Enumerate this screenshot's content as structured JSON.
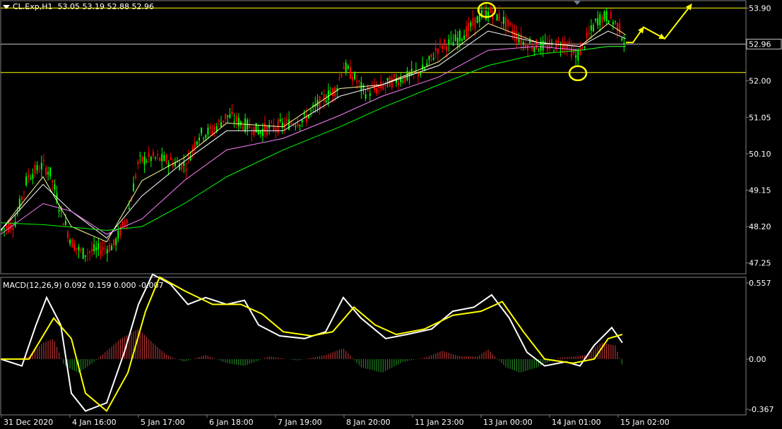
{
  "header": {
    "symbol": "CL.Exp,H1",
    "ohlc": "53.05 53.19 52.88 52.96"
  },
  "macd_header": {
    "label": "MACD(12,26,9)",
    "values": "0.092 0.159 0.000 -0.007"
  },
  "colors": {
    "background": "#000000",
    "bull_candle": "#00ff00",
    "bear_candle": "#ff0000",
    "level_line": "#ffff00",
    "bid_line": "#c0c0c0",
    "ma_fast": "#ffff99",
    "ma_mid": "#ffffff",
    "ma_slow": "#ff80ff",
    "ma_long": "#00ff00",
    "macd_main": "#ffffff",
    "macd_signal": "#ffff00",
    "annotation": "#ffff00"
  },
  "chart_data": [
    {
      "type": "candlestick",
      "price_axis": [
        "53.90",
        "52.96",
        "52.00",
        "51.05",
        "50.10",
        "49.15",
        "48.20",
        "47.25"
      ],
      "current_price": "52.96",
      "ylim": [
        46.95,
        54.0
      ],
      "time_axis": [
        "31 Dec 2020",
        "4 Jan 16:00",
        "5 Jan 17:00",
        "6 Jan 18:00",
        "7 Jan 19:00",
        "8 Jan 20:00",
        "11 Jan 23:00",
        "13 Jan 00:00",
        "14 Jan 01:00",
        "15 Jan 02:00"
      ],
      "horizontal_levels": [
        53.9,
        52.22
      ],
      "close_path": [
        [
          0,
          48.1
        ],
        [
          20,
          48.3
        ],
        [
          38,
          49.5
        ],
        [
          60,
          49.8
        ],
        [
          70,
          49.6
        ],
        [
          85,
          48.6
        ],
        [
          100,
          47.8
        ],
        [
          115,
          47.5
        ],
        [
          140,
          47.6
        ],
        [
          160,
          47.7
        ],
        [
          180,
          48.5
        ],
        [
          195,
          49.9
        ],
        [
          215,
          50.0
        ],
        [
          240,
          49.9
        ],
        [
          262,
          49.8
        ],
        [
          280,
          50.6
        ],
        [
          300,
          50.7
        ],
        [
          320,
          51.1
        ],
        [
          340,
          50.9
        ],
        [
          365,
          50.7
        ],
        [
          390,
          50.8
        ],
        [
          410,
          50.9
        ],
        [
          430,
          51.0
        ],
        [
          455,
          51.5
        ],
        [
          475,
          51.8
        ],
        [
          485,
          52.4
        ],
        [
          500,
          52.1
        ],
        [
          515,
          51.7
        ],
        [
          535,
          51.8
        ],
        [
          555,
          52.0
        ],
        [
          575,
          52.1
        ],
        [
          600,
          52.3
        ],
        [
          620,
          52.9
        ],
        [
          640,
          53.0
        ],
        [
          660,
          53.3
        ],
        [
          680,
          53.7
        ],
        [
          695,
          53.8
        ],
        [
          710,
          53.6
        ],
        [
          725,
          53.3
        ],
        [
          740,
          53.0
        ],
        [
          760,
          52.9
        ],
        [
          780,
          52.9
        ],
        [
          800,
          53.0
        ],
        [
          815,
          52.6
        ],
        [
          830,
          53.1
        ],
        [
          845,
          53.6
        ],
        [
          860,
          53.7
        ],
        [
          875,
          53.4
        ],
        [
          885,
          52.96
        ]
      ],
      "series": [
        {
          "name": "MA fast",
          "values": [
            [
              0,
              48.1
            ],
            [
              60,
              49.5
            ],
            [
              100,
              48.2
            ],
            [
              150,
              47.8
            ],
            [
              200,
              49.4
            ],
            [
              260,
              50.0
            ],
            [
              320,
              50.9
            ],
            [
              400,
              50.8
            ],
            [
              480,
              51.8
            ],
            [
              540,
              51.9
            ],
            [
              620,
              52.5
            ],
            [
              690,
              53.5
            ],
            [
              760,
              53.0
            ],
            [
              820,
              52.9
            ],
            [
              860,
              53.5
            ],
            [
              885,
              53.2
            ]
          ]
        },
        {
          "name": "MA mid",
          "values": [
            [
              0,
              48.1
            ],
            [
              60,
              49.3
            ],
            [
              100,
              48.6
            ],
            [
              150,
              47.9
            ],
            [
              200,
              49.0
            ],
            [
              260,
              49.9
            ],
            [
              320,
              50.7
            ],
            [
              400,
              50.7
            ],
            [
              480,
              51.6
            ],
            [
              540,
              51.9
            ],
            [
              620,
              52.4
            ],
            [
              690,
              53.3
            ],
            [
              760,
              53.0
            ],
            [
              820,
              52.9
            ],
            [
              860,
              53.3
            ],
            [
              885,
              53.1
            ]
          ]
        },
        {
          "name": "MA slow",
          "values": [
            [
              0,
              48.0
            ],
            [
              60,
              48.8
            ],
            [
              100,
              48.6
            ],
            [
              150,
              48.0
            ],
            [
              200,
              48.4
            ],
            [
              260,
              49.4
            ],
            [
              320,
              50.2
            ],
            [
              400,
              50.5
            ],
            [
              480,
              51.1
            ],
            [
              540,
              51.6
            ],
            [
              620,
              52.1
            ],
            [
              690,
              52.8
            ],
            [
              760,
              52.9
            ],
            [
              820,
              52.8
            ],
            [
              860,
              52.9
            ],
            [
              885,
              52.9
            ]
          ]
        },
        {
          "name": "MA long",
          "values": [
            [
              0,
              48.3
            ],
            [
              60,
              48.25
            ],
            [
              150,
              48.1
            ],
            [
              200,
              48.2
            ],
            [
              260,
              48.8
            ],
            [
              320,
              49.5
            ],
            [
              400,
              50.2
            ],
            [
              480,
              50.8
            ],
            [
              540,
              51.3
            ],
            [
              620,
              51.9
            ],
            [
              690,
              52.4
            ],
            [
              760,
              52.7
            ],
            [
              820,
              52.8
            ],
            [
              860,
              52.9
            ],
            [
              885,
              52.9
            ]
          ]
        }
      ],
      "annotations": {
        "circles": [
          [
            688,
            53.85
          ],
          [
            817,
            52.2
          ]
        ],
        "forecast_arrow": [
          [
            885,
            53.0
          ],
          [
            895,
            53.0
          ],
          [
            910,
            53.4
          ],
          [
            940,
            53.1
          ],
          [
            978,
            54.0
          ]
        ]
      }
    },
    {
      "type": "macd",
      "axis": [
        "0.557",
        "0.00",
        "-0.367"
      ],
      "ylim": [
        -0.367,
        0.557
      ],
      "macd_line": [
        [
          0,
          0.0
        ],
        [
          30,
          -0.05
        ],
        [
          50,
          0.25
        ],
        [
          65,
          0.45
        ],
        [
          85,
          0.25
        ],
        [
          100,
          -0.25
        ],
        [
          120,
          -0.38
        ],
        [
          150,
          -0.32
        ],
        [
          175,
          0.05
        ],
        [
          195,
          0.4
        ],
        [
          215,
          0.62
        ],
        [
          240,
          0.55
        ],
        [
          265,
          0.4
        ],
        [
          290,
          0.45
        ],
        [
          320,
          0.4
        ],
        [
          345,
          0.43
        ],
        [
          365,
          0.25
        ],
        [
          395,
          0.17
        ],
        [
          430,
          0.15
        ],
        [
          460,
          0.2
        ],
        [
          485,
          0.45
        ],
        [
          510,
          0.3
        ],
        [
          545,
          0.15
        ],
        [
          575,
          0.18
        ],
        [
          610,
          0.22
        ],
        [
          640,
          0.35
        ],
        [
          670,
          0.38
        ],
        [
          695,
          0.47
        ],
        [
          720,
          0.3
        ],
        [
          745,
          0.05
        ],
        [
          770,
          -0.05
        ],
        [
          800,
          -0.02
        ],
        [
          820,
          -0.05
        ],
        [
          840,
          0.1
        ],
        [
          865,
          0.23
        ],
        [
          880,
          0.12
        ]
      ],
      "signal_line": [
        [
          0,
          0.0
        ],
        [
          40,
          0.0
        ],
        [
          75,
          0.3
        ],
        [
          100,
          0.15
        ],
        [
          120,
          -0.25
        ],
        [
          150,
          -0.38
        ],
        [
          180,
          -0.1
        ],
        [
          205,
          0.35
        ],
        [
          225,
          0.6
        ],
        [
          260,
          0.5
        ],
        [
          300,
          0.4
        ],
        [
          340,
          0.4
        ],
        [
          370,
          0.33
        ],
        [
          400,
          0.2
        ],
        [
          440,
          0.17
        ],
        [
          470,
          0.2
        ],
        [
          500,
          0.38
        ],
        [
          530,
          0.25
        ],
        [
          560,
          0.18
        ],
        [
          600,
          0.22
        ],
        [
          640,
          0.32
        ],
        [
          680,
          0.35
        ],
        [
          710,
          0.42
        ],
        [
          740,
          0.2
        ],
        [
          770,
          0.0
        ],
        [
          810,
          -0.03
        ],
        [
          840,
          0.0
        ],
        [
          860,
          0.15
        ],
        [
          880,
          0.18
        ]
      ],
      "histogram": [
        [
          0,
          0.0
        ],
        [
          20,
          0.0
        ],
        [
          40,
          0.02
        ],
        [
          60,
          0.12
        ],
        [
          75,
          0.15
        ],
        [
          90,
          -0.05
        ],
        [
          110,
          -0.1
        ],
        [
          130,
          -0.03
        ],
        [
          150,
          0.06
        ],
        [
          170,
          0.15
        ],
        [
          195,
          0.22
        ],
        [
          215,
          0.12
        ],
        [
          235,
          0.03
        ],
        [
          260,
          -0.02
        ],
        [
          290,
          0.03
        ],
        [
          320,
          -0.03
        ],
        [
          345,
          -0.05
        ],
        [
          380,
          0.02
        ],
        [
          420,
          -0.01
        ],
        [
          460,
          0.03
        ],
        [
          485,
          0.08
        ],
        [
          510,
          -0.06
        ],
        [
          540,
          -0.1
        ],
        [
          570,
          -0.02
        ],
        [
          600,
          0.01
        ],
        [
          625,
          0.06
        ],
        [
          650,
          0.02
        ],
        [
          675,
          0.02
        ],
        [
          690,
          0.07
        ],
        [
          715,
          -0.06
        ],
        [
          735,
          -0.1
        ],
        [
          760,
          -0.06
        ],
        [
          790,
          0.01
        ],
        [
          810,
          0.02
        ],
        [
          830,
          0.03
        ],
        [
          850,
          0.12
        ],
        [
          870,
          0.1
        ],
        [
          880,
          -0.05
        ]
      ]
    }
  ]
}
